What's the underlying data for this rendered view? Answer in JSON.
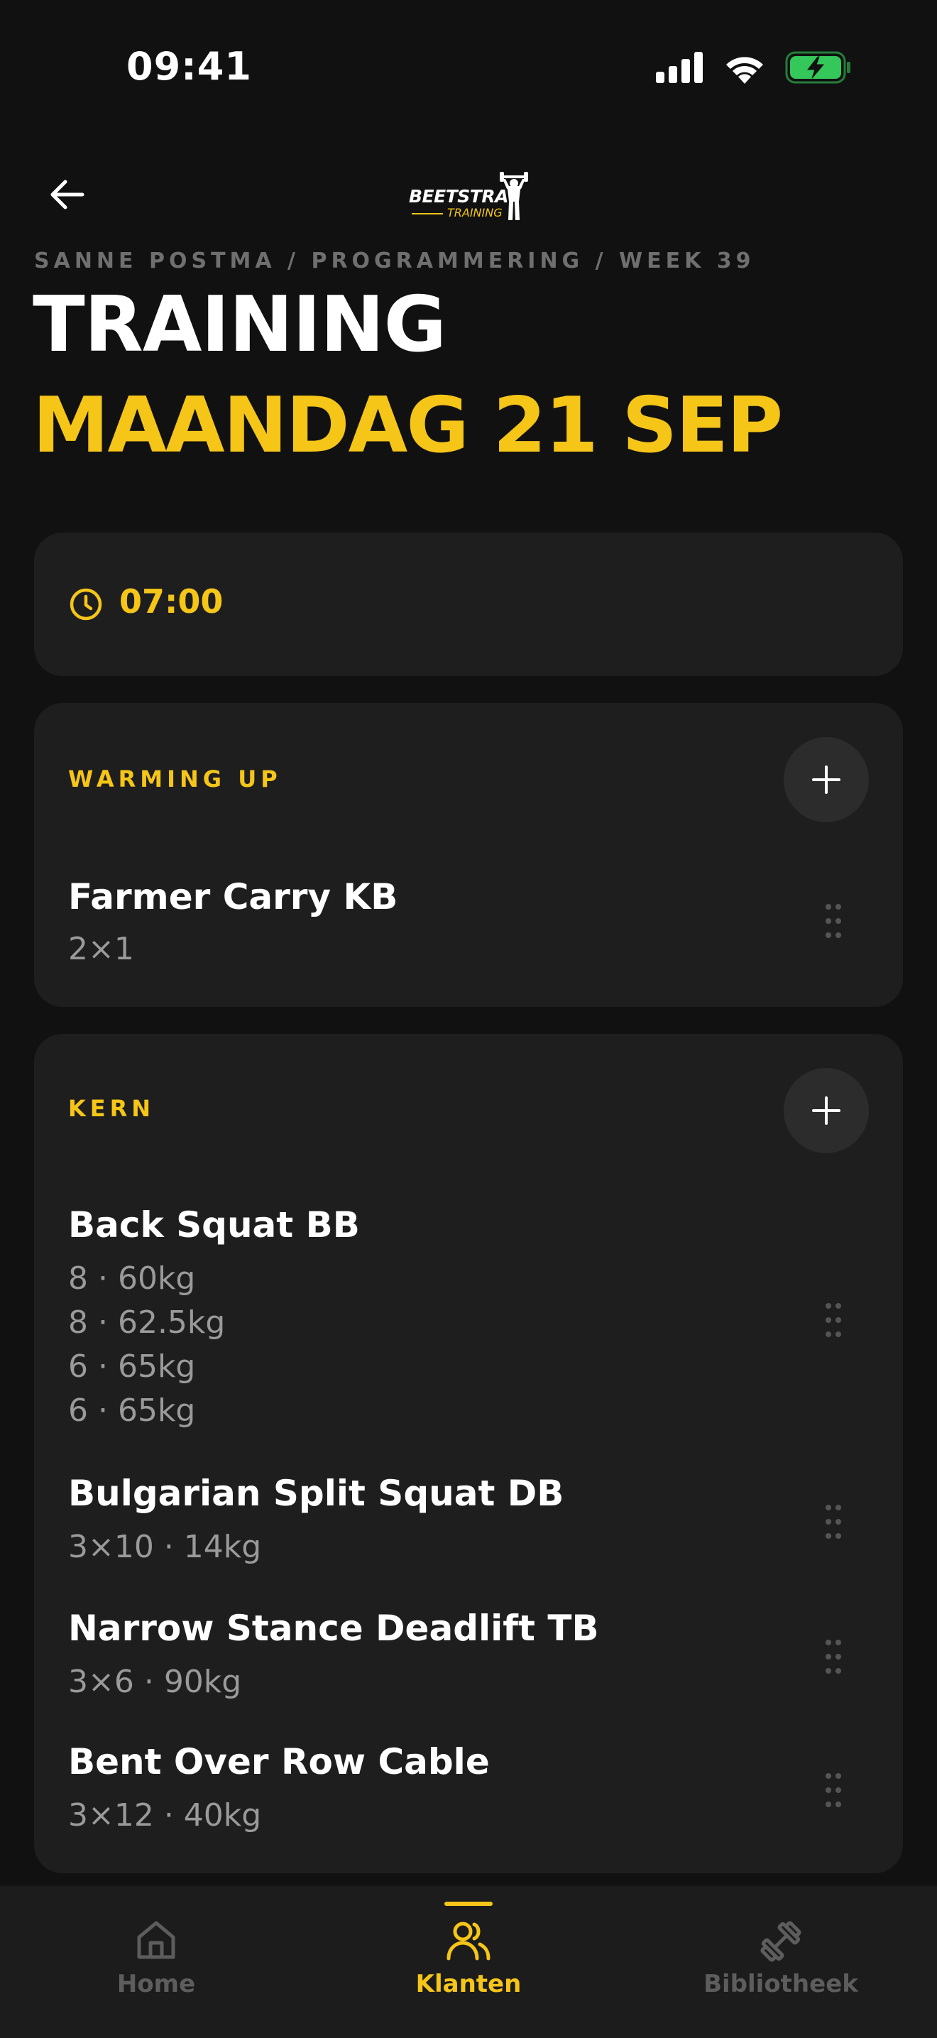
{
  "status_bar": {
    "time": "09:41"
  },
  "header": {
    "logo_main": "BEETSTRA",
    "logo_sub": "TRAINING",
    "breadcrumb": "SANNE POSTMA / PROGRAMMERING / WEEK 39",
    "title": "TRAINING",
    "date": "MAANDAG 21 SEP"
  },
  "session": {
    "time": "07:00"
  },
  "sections": {
    "warmup": {
      "title": "WARMING UP",
      "exercises": [
        {
          "name": "Farmer Carry KB",
          "sets": [
            "2×1"
          ]
        }
      ]
    },
    "kern": {
      "title": "KERN",
      "exercises": [
        {
          "name": "Back Squat BB",
          "sets": [
            "8 · 60kg",
            "8 · 62.5kg",
            "6 · 65kg",
            "6 · 65kg"
          ]
        },
        {
          "name": "Bulgarian Split Squat DB",
          "sets": [
            "3×10 · 14kg"
          ]
        },
        {
          "name": "Narrow Stance Deadlift TB",
          "sets": [
            "3×6 · 90kg"
          ]
        },
        {
          "name": "Bent Over Row Cable",
          "sets": [
            "3×12 · 40kg"
          ]
        }
      ]
    }
  },
  "tab_bar": {
    "tabs": [
      {
        "label": "Home",
        "icon": "home-icon",
        "active": false
      },
      {
        "label": "Klanten",
        "icon": "users-icon",
        "active": true
      },
      {
        "label": "Bibliotheek",
        "icon": "dumbbell-icon",
        "active": false
      }
    ]
  },
  "colors": {
    "background": "#111111",
    "card": "#1e1e1e",
    "accent": "#f5c518",
    "muted_text": "#9a9a9a",
    "battery": "#34c759"
  }
}
